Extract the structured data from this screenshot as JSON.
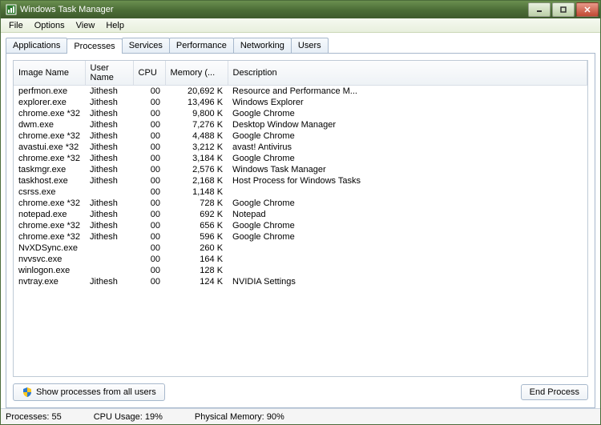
{
  "window": {
    "title": "Windows Task Manager"
  },
  "menu": {
    "items": [
      "File",
      "Options",
      "View",
      "Help"
    ]
  },
  "tabs": [
    "Applications",
    "Processes",
    "Services",
    "Performance",
    "Networking",
    "Users"
  ],
  "active_tab": 1,
  "columns": [
    "Image Name",
    "User Name",
    "CPU",
    "Memory (...",
    "Description"
  ],
  "processes": [
    {
      "img": "perfmon.exe",
      "user": "Jithesh",
      "cpu": "00",
      "mem": "20,692 K",
      "desc": "Resource and Performance M..."
    },
    {
      "img": "explorer.exe",
      "user": "Jithesh",
      "cpu": "00",
      "mem": "13,496 K",
      "desc": "Windows Explorer"
    },
    {
      "img": "chrome.exe *32",
      "user": "Jithesh",
      "cpu": "00",
      "mem": "9,800 K",
      "desc": "Google Chrome"
    },
    {
      "img": "dwm.exe",
      "user": "Jithesh",
      "cpu": "00",
      "mem": "7,276 K",
      "desc": "Desktop Window Manager"
    },
    {
      "img": "chrome.exe *32",
      "user": "Jithesh",
      "cpu": "00",
      "mem": "4,488 K",
      "desc": "Google Chrome"
    },
    {
      "img": "avastui.exe *32",
      "user": "Jithesh",
      "cpu": "00",
      "mem": "3,212 K",
      "desc": "avast! Antivirus"
    },
    {
      "img": "chrome.exe *32",
      "user": "Jithesh",
      "cpu": "00",
      "mem": "3,184 K",
      "desc": "Google Chrome"
    },
    {
      "img": "taskmgr.exe",
      "user": "Jithesh",
      "cpu": "00",
      "mem": "2,576 K",
      "desc": "Windows Task Manager"
    },
    {
      "img": "taskhost.exe",
      "user": "Jithesh",
      "cpu": "00",
      "mem": "2,168 K",
      "desc": "Host Process for Windows Tasks"
    },
    {
      "img": "csrss.exe",
      "user": "",
      "cpu": "00",
      "mem": "1,148 K",
      "desc": ""
    },
    {
      "img": "chrome.exe *32",
      "user": "Jithesh",
      "cpu": "00",
      "mem": "728 K",
      "desc": "Google Chrome"
    },
    {
      "img": "notepad.exe",
      "user": "Jithesh",
      "cpu": "00",
      "mem": "692 K",
      "desc": "Notepad"
    },
    {
      "img": "chrome.exe *32",
      "user": "Jithesh",
      "cpu": "00",
      "mem": "656 K",
      "desc": "Google Chrome"
    },
    {
      "img": "chrome.exe *32",
      "user": "Jithesh",
      "cpu": "00",
      "mem": "596 K",
      "desc": "Google Chrome"
    },
    {
      "img": "NvXDSync.exe",
      "user": "",
      "cpu": "00",
      "mem": "260 K",
      "desc": ""
    },
    {
      "img": "nvvsvc.exe",
      "user": "",
      "cpu": "00",
      "mem": "164 K",
      "desc": ""
    },
    {
      "img": "winlogon.exe",
      "user": "",
      "cpu": "00",
      "mem": "128 K",
      "desc": ""
    },
    {
      "img": "nvtray.exe",
      "user": "Jithesh",
      "cpu": "00",
      "mem": "124 K",
      "desc": "NVIDIA Settings"
    }
  ],
  "buttons": {
    "show_all": "Show processes from all users",
    "end_process": "End Process"
  },
  "status": {
    "processes": "Processes: 55",
    "cpu": "CPU Usage: 19%",
    "memory": "Physical Memory: 90%"
  }
}
